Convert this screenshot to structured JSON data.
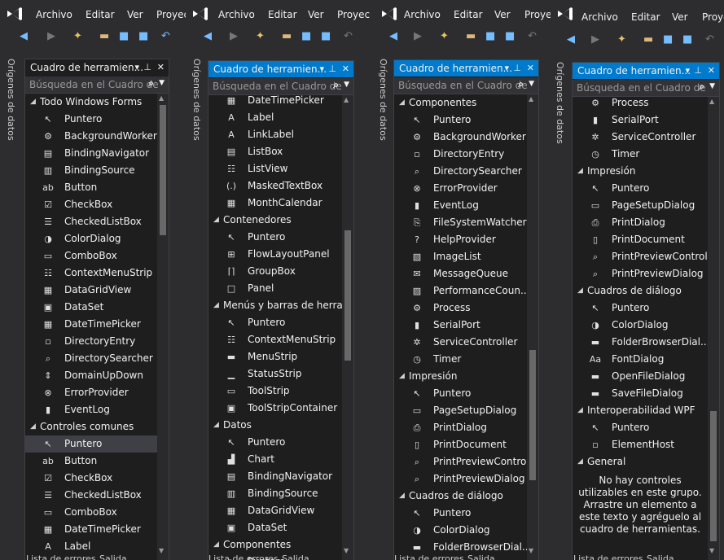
{
  "colors": {
    "background": "#2d2d30",
    "toolbox_background": "#1e1e1e",
    "active_header": "#007acc",
    "logo": "#68217a"
  },
  "menubar": {
    "file": "Archivo",
    "edit": "Editar",
    "view": "Ver",
    "project": "Proyec"
  },
  "side_tab": {
    "label": "Orígenes de datos"
  },
  "bottom_tabs": {
    "errors": "Lista de errores",
    "output": "Salida"
  },
  "toolbox": {
    "title": "Cuadro de herramien...",
    "search_placeholder": "Búsqueda en el Cuadro de"
  },
  "panel1": {
    "rows": [
      {
        "type": "category",
        "label": "Todo Windows Forms",
        "icon": "triangle-down-icon"
      },
      {
        "type": "item",
        "label": "Puntero",
        "icon": "pointer-icon"
      },
      {
        "type": "item",
        "label": "BackgroundWorker",
        "icon": "backgroundworker-icon"
      },
      {
        "type": "item",
        "label": "BindingNavigator",
        "icon": "bindingnavigator-icon"
      },
      {
        "type": "item",
        "label": "BindingSource",
        "icon": "bindingsource-icon"
      },
      {
        "type": "item",
        "label": "Button",
        "icon": "button-icon"
      },
      {
        "type": "item",
        "label": "CheckBox",
        "icon": "checkbox-icon"
      },
      {
        "type": "item",
        "label": "CheckedListBox",
        "icon": "checkedlistbox-icon"
      },
      {
        "type": "item",
        "label": "ColorDialog",
        "icon": "colordialog-icon"
      },
      {
        "type": "item",
        "label": "ComboBox",
        "icon": "combobox-icon"
      },
      {
        "type": "item",
        "label": "ContextMenuStrip",
        "icon": "contextmenustrip-icon"
      },
      {
        "type": "item",
        "label": "DataGridView",
        "icon": "datagridview-icon"
      },
      {
        "type": "item",
        "label": "DataSet",
        "icon": "dataset-icon"
      },
      {
        "type": "item",
        "label": "DateTimePicker",
        "icon": "datetimepicker-icon"
      },
      {
        "type": "item",
        "label": "DirectoryEntry",
        "icon": "directoryentry-icon"
      },
      {
        "type": "item",
        "label": "DirectorySearcher",
        "icon": "directorysearcher-icon"
      },
      {
        "type": "item",
        "label": "DomainUpDown",
        "icon": "domainupdown-icon"
      },
      {
        "type": "item",
        "label": "ErrorProvider",
        "icon": "errorprovider-icon"
      },
      {
        "type": "item",
        "label": "EventLog",
        "icon": "eventlog-icon"
      },
      {
        "type": "category",
        "label": "Controles comunes",
        "icon": "triangle-down-icon"
      },
      {
        "type": "item",
        "label": "Puntero",
        "icon": "pointer-icon",
        "selected": true
      },
      {
        "type": "item",
        "label": "Button",
        "icon": "button-icon"
      },
      {
        "type": "item",
        "label": "CheckBox",
        "icon": "checkbox-icon"
      },
      {
        "type": "item",
        "label": "CheckedListBox",
        "icon": "checkedlistbox-icon"
      },
      {
        "type": "item",
        "label": "ComboBox",
        "icon": "combobox-icon"
      },
      {
        "type": "item",
        "label": "DateTimePicker",
        "icon": "datetimepicker-icon"
      },
      {
        "type": "item",
        "label": "Label",
        "icon": "label-icon"
      }
    ]
  },
  "panel2": {
    "rows": [
      {
        "type": "item",
        "label": "DateTimePicker",
        "icon": "datetimepicker-icon"
      },
      {
        "type": "item",
        "label": "Label",
        "icon": "label-icon"
      },
      {
        "type": "item",
        "label": "LinkLabel",
        "icon": "linklabel-icon"
      },
      {
        "type": "item",
        "label": "ListBox",
        "icon": "listbox-icon"
      },
      {
        "type": "item",
        "label": "ListView",
        "icon": "listview-icon"
      },
      {
        "type": "item",
        "label": "MaskedTextBox",
        "icon": "maskedtextbox-icon"
      },
      {
        "type": "item",
        "label": "MonthCalendar",
        "icon": "monthcalendar-icon"
      },
      {
        "type": "category",
        "label": "Contenedores",
        "icon": "triangle-down-icon"
      },
      {
        "type": "item",
        "label": "Puntero",
        "icon": "pointer-icon"
      },
      {
        "type": "item",
        "label": "FlowLayoutPanel",
        "icon": "flowlayoutpanel-icon"
      },
      {
        "type": "item",
        "label": "GroupBox",
        "icon": "groupbox-icon"
      },
      {
        "type": "item",
        "label": "Panel",
        "icon": "panel-icon"
      },
      {
        "type": "category",
        "label": "Menús y barras de herra...",
        "icon": "triangle-down-icon"
      },
      {
        "type": "item",
        "label": "Puntero",
        "icon": "pointer-icon"
      },
      {
        "type": "item",
        "label": "ContextMenuStrip",
        "icon": "contextmenustrip-icon"
      },
      {
        "type": "item",
        "label": "MenuStrip",
        "icon": "menustrip-icon"
      },
      {
        "type": "item",
        "label": "StatusStrip",
        "icon": "statusstrip-icon"
      },
      {
        "type": "item",
        "label": "ToolStrip",
        "icon": "toolstrip-icon"
      },
      {
        "type": "item",
        "label": "ToolStripContainer",
        "icon": "toolstripcontainer-icon"
      },
      {
        "type": "category",
        "label": "Datos",
        "icon": "triangle-down-icon"
      },
      {
        "type": "item",
        "label": "Puntero",
        "icon": "pointer-icon"
      },
      {
        "type": "item",
        "label": "Chart",
        "icon": "chart-icon"
      },
      {
        "type": "item",
        "label": "BindingNavigator",
        "icon": "bindingnavigator-icon"
      },
      {
        "type": "item",
        "label": "BindingSource",
        "icon": "bindingsource-icon"
      },
      {
        "type": "item",
        "label": "DataGridView",
        "icon": "datagridview-icon"
      },
      {
        "type": "item",
        "label": "DataSet",
        "icon": "dataset-icon"
      },
      {
        "type": "category",
        "label": "Componentes",
        "icon": "triangle-down-icon"
      },
      {
        "type": "item",
        "label": "Puntero",
        "icon": "pointer-icon"
      }
    ]
  },
  "panel3": {
    "rows": [
      {
        "type": "category",
        "label": "Componentes",
        "icon": "triangle-down-icon"
      },
      {
        "type": "item",
        "label": "Puntero",
        "icon": "pointer-icon"
      },
      {
        "type": "item",
        "label": "BackgroundWorker",
        "icon": "backgroundworker-icon"
      },
      {
        "type": "item",
        "label": "DirectoryEntry",
        "icon": "directoryentry-icon"
      },
      {
        "type": "item",
        "label": "DirectorySearcher",
        "icon": "directorysearcher-icon"
      },
      {
        "type": "item",
        "label": "ErrorProvider",
        "icon": "errorprovider-icon"
      },
      {
        "type": "item",
        "label": "EventLog",
        "icon": "eventlog-icon"
      },
      {
        "type": "item",
        "label": "FileSystemWatcher",
        "icon": "filesystemwatcher-icon"
      },
      {
        "type": "item",
        "label": "HelpProvider",
        "icon": "helpprovider-icon"
      },
      {
        "type": "item",
        "label": "ImageList",
        "icon": "imagelist-icon"
      },
      {
        "type": "item",
        "label": "MessageQueue",
        "icon": "messagequeue-icon"
      },
      {
        "type": "item",
        "label": "PerformanceCoun...",
        "icon": "performancecounter-icon"
      },
      {
        "type": "item",
        "label": "Process",
        "icon": "process-icon"
      },
      {
        "type": "item",
        "label": "SerialPort",
        "icon": "serialport-icon"
      },
      {
        "type": "item",
        "label": "ServiceController",
        "icon": "servicecontroller-icon"
      },
      {
        "type": "item",
        "label": "Timer",
        "icon": "timer-icon"
      },
      {
        "type": "category",
        "label": "Impresión",
        "icon": "triangle-down-icon"
      },
      {
        "type": "item",
        "label": "Puntero",
        "icon": "pointer-icon"
      },
      {
        "type": "item",
        "label": "PageSetupDialog",
        "icon": "pagesetupdialog-icon"
      },
      {
        "type": "item",
        "label": "PrintDialog",
        "icon": "printdialog-icon"
      },
      {
        "type": "item",
        "label": "PrintDocument",
        "icon": "printdocument-icon"
      },
      {
        "type": "item",
        "label": "PrintPreviewControl",
        "icon": "printpreviewcontrol-icon"
      },
      {
        "type": "item",
        "label": "PrintPreviewDialog",
        "icon": "printpreviewdialog-icon"
      },
      {
        "type": "category",
        "label": "Cuadros de diálogo",
        "icon": "triangle-down-icon"
      },
      {
        "type": "item",
        "label": "Puntero",
        "icon": "pointer-icon"
      },
      {
        "type": "item",
        "label": "ColorDialog",
        "icon": "colordialog-icon"
      },
      {
        "type": "item",
        "label": "FolderBrowserDial...",
        "icon": "folderbrowserdialog-icon"
      }
    ]
  },
  "panel4": {
    "rows": [
      {
        "type": "item",
        "label": "Process",
        "icon": "process-icon"
      },
      {
        "type": "item",
        "label": "SerialPort",
        "icon": "serialport-icon"
      },
      {
        "type": "item",
        "label": "ServiceController",
        "icon": "servicecontroller-icon"
      },
      {
        "type": "item",
        "label": "Timer",
        "icon": "timer-icon"
      },
      {
        "type": "category",
        "label": "Impresión",
        "icon": "triangle-down-icon"
      },
      {
        "type": "item",
        "label": "Puntero",
        "icon": "pointer-icon"
      },
      {
        "type": "item",
        "label": "PageSetupDialog",
        "icon": "pagesetupdialog-icon"
      },
      {
        "type": "item",
        "label": "PrintDialog",
        "icon": "printdialog-icon"
      },
      {
        "type": "item",
        "label": "PrintDocument",
        "icon": "printdocument-icon"
      },
      {
        "type": "item",
        "label": "PrintPreviewControl",
        "icon": "printpreviewcontrol-icon"
      },
      {
        "type": "item",
        "label": "PrintPreviewDialog",
        "icon": "printpreviewdialog-icon"
      },
      {
        "type": "category",
        "label": "Cuadros de diálogo",
        "icon": "triangle-down-icon"
      },
      {
        "type": "item",
        "label": "Puntero",
        "icon": "pointer-icon"
      },
      {
        "type": "item",
        "label": "ColorDialog",
        "icon": "colordialog-icon"
      },
      {
        "type": "item",
        "label": "FolderBrowserDial...",
        "icon": "folderbrowserdialog-icon"
      },
      {
        "type": "item",
        "label": "FontDialog",
        "icon": "fontdialog-icon"
      },
      {
        "type": "item",
        "label": "OpenFileDialog",
        "icon": "openfiledialog-icon"
      },
      {
        "type": "item",
        "label": "SaveFileDialog",
        "icon": "savefiledialog-icon"
      },
      {
        "type": "category",
        "label": "Interoperabilidad WPF",
        "icon": "triangle-down-icon"
      },
      {
        "type": "item",
        "label": "Puntero",
        "icon": "pointer-icon"
      },
      {
        "type": "item",
        "label": "ElementHost",
        "icon": "elementhost-icon"
      },
      {
        "type": "category",
        "label": "General",
        "icon": "triangle-down-icon"
      }
    ],
    "empty_message": [
      "No hay controles",
      "utilizables en este grupo.",
      "Arrastre un elemento a",
      "este texto y agréguelo al",
      "cuadro de herramientas."
    ]
  }
}
